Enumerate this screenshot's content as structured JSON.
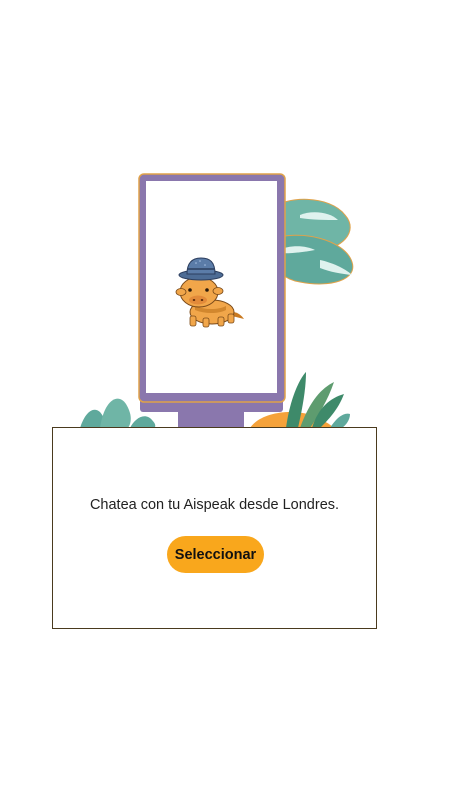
{
  "card": {
    "message": "Chatea con tu Aispeak desde Londres.",
    "select_label": "Seleccionar"
  },
  "colors": {
    "frame": "#8a77ad",
    "frame_outline": "#e0a24a",
    "foliage": "#5fa99c",
    "foliage_dark": "#2f7d75",
    "grass": "#5e9c6f",
    "accent_orange": "#f5a23a",
    "button": "#f9a71c",
    "card_border": "#4a3a1e"
  },
  "icons": {
    "mascot": "cow-mascot-with-bucket-hat-icon",
    "plants": "tropical-leaves-decoration"
  }
}
